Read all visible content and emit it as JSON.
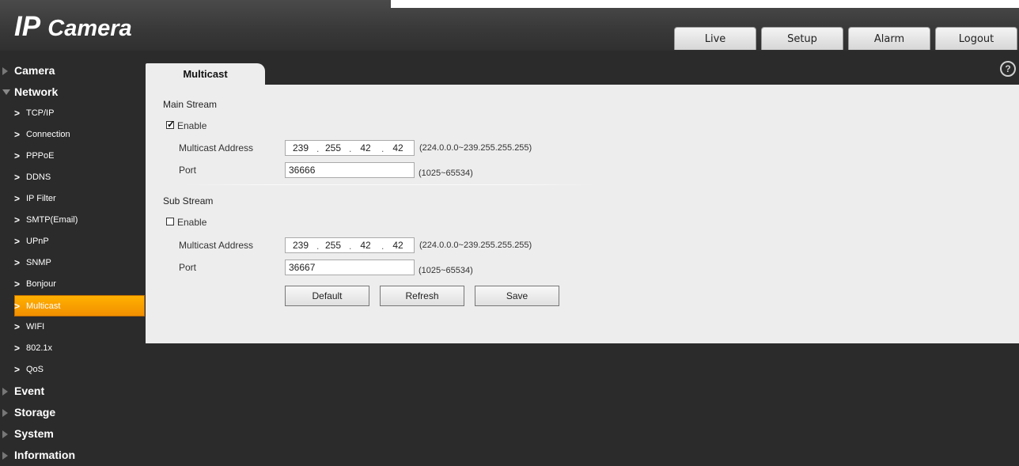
{
  "header": {
    "logo_ip": "IP",
    "logo_camera": "Camera",
    "tabs": [
      {
        "label": "Live"
      },
      {
        "label": "Setup"
      },
      {
        "label": "Alarm"
      },
      {
        "label": "Logout"
      }
    ]
  },
  "sidebar": {
    "categories": [
      {
        "label": "Camera"
      },
      {
        "label": "Network"
      },
      {
        "label": "Event"
      },
      {
        "label": "Storage"
      },
      {
        "label": "System"
      },
      {
        "label": "Information"
      }
    ],
    "network_items": [
      {
        "label": "TCP/IP"
      },
      {
        "label": "Connection"
      },
      {
        "label": "PPPoE"
      },
      {
        "label": "DDNS"
      },
      {
        "label": "IP Filter"
      },
      {
        "label": "SMTP(Email)"
      },
      {
        "label": "UPnP"
      },
      {
        "label": "SNMP"
      },
      {
        "label": "Bonjour"
      },
      {
        "label": "Multicast"
      },
      {
        "label": "WIFI"
      },
      {
        "label": "802.1x"
      },
      {
        "label": "QoS"
      }
    ],
    "active_item": "Multicast"
  },
  "content": {
    "tab_label": "Multicast",
    "main_stream": {
      "title": "Main Stream",
      "enable_label": "Enable",
      "enabled": true,
      "address_label": "Multicast Address",
      "address": [
        "239",
        "255",
        "42",
        "42"
      ],
      "address_range": "(224.0.0.0~239.255.255.255)",
      "port_label": "Port",
      "port": "36666",
      "port_range": "(1025~65534)"
    },
    "sub_stream": {
      "title": "Sub Stream",
      "enable_label": "Enable",
      "enabled": false,
      "address_label": "Multicast Address",
      "address": [
        "239",
        "255",
        "42",
        "42"
      ],
      "address_range": "(224.0.0.0~239.255.255.255)",
      "port_label": "Port",
      "port": "36667",
      "port_range": "(1025~65534)"
    },
    "buttons": {
      "default": "Default",
      "refresh": "Refresh",
      "save": "Save"
    }
  },
  "colors": {
    "accent": "#f29000",
    "background": "#2b2b2b",
    "panel": "#ededed"
  }
}
